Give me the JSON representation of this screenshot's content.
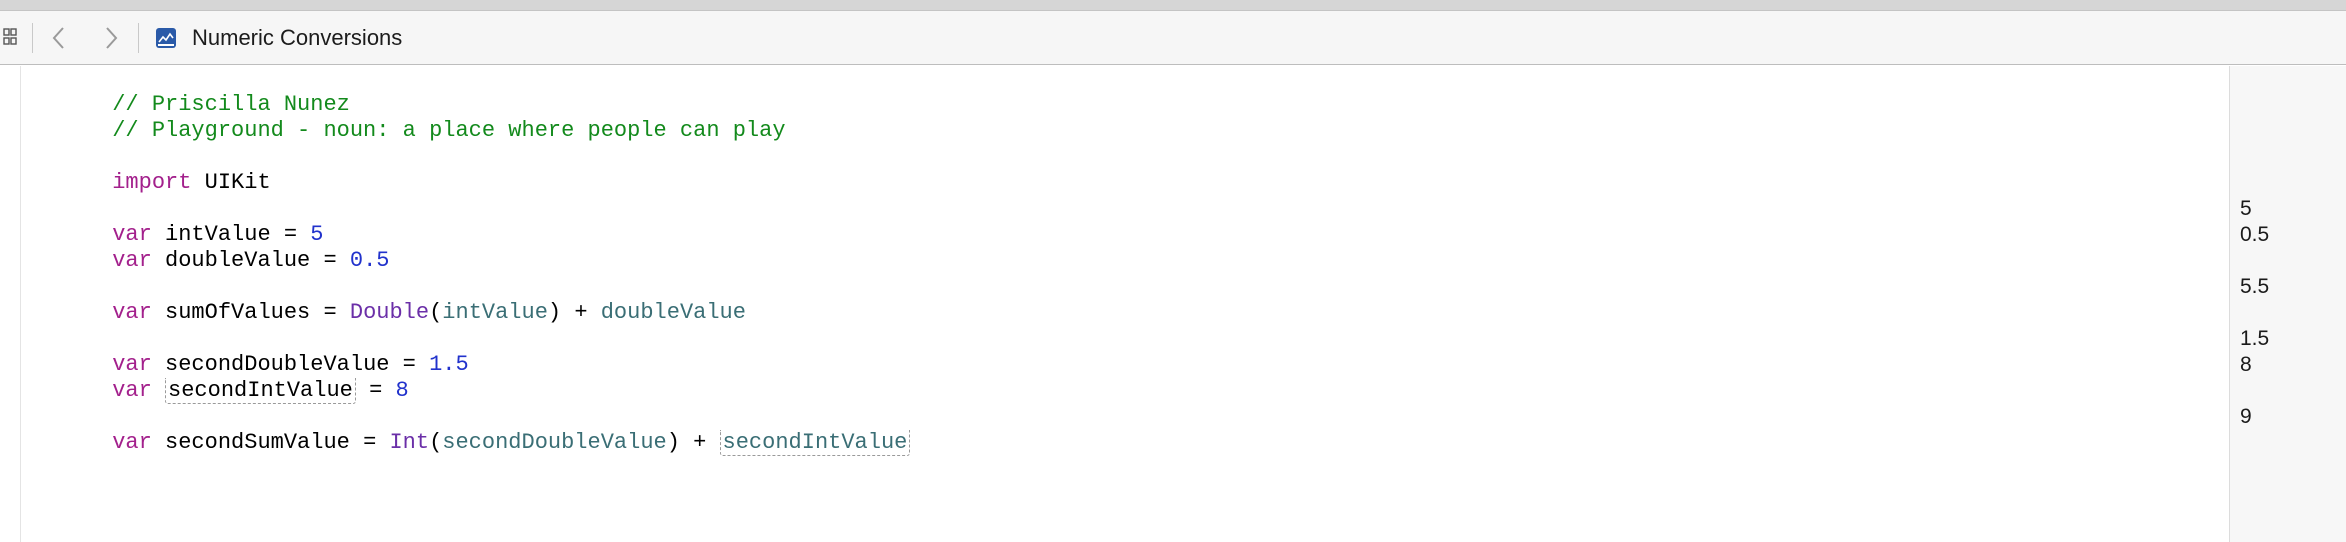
{
  "jump_bar": {
    "file_title": "Numeric Conversions",
    "icons": {
      "grid": "grid-icon",
      "back": "chevron-left-icon",
      "forward": "chevron-right-icon",
      "file": "playground-file-icon"
    }
  },
  "editor": {
    "lines": {
      "l1": "// Priscilla Nunez",
      "l2": "// Playground - noun: a place where people can play",
      "l4_kw": "import",
      "l4_rest": " UIKit",
      "l6_kw": "var",
      "l6_a": " intValue = ",
      "l6_num": "5",
      "l7_kw": "var",
      "l7_a": " doubleValue = ",
      "l7_num": "0.5",
      "l9_kw": "var",
      "l9_a": " sumOfValues = ",
      "l9_type": "Double",
      "l9_b": "(",
      "l9_ident1": "intValue",
      "l9_c": ") + ",
      "l9_ident2": "doubleValue",
      "l11_kw": "var",
      "l11_a": " secondDoubleValue = ",
      "l11_num": "1.5",
      "l12_kw": "var",
      "l12_sp": " ",
      "l12_ident": "secondIntValue",
      "l12_a": " = ",
      "l12_num": "8",
      "l14_kw": "var",
      "l14_a": " secondSumValue = ",
      "l14_type": "Int",
      "l14_b": "(",
      "l14_ident1": "secondDoubleValue",
      "l14_c": ") + ",
      "l14_ident2": "secondIntValue"
    }
  },
  "results": {
    "r_int": "5",
    "r_double": "0.5",
    "r_sum": "5.5",
    "r_second_double": "1.5",
    "r_second_int": "8",
    "r_second_sum": "9"
  },
  "colors": {
    "comment": "#138a1c",
    "keyword": "#a3208c",
    "type": "#6b2fa8",
    "number": "#2132cc",
    "identifier": "#3a6e75"
  }
}
